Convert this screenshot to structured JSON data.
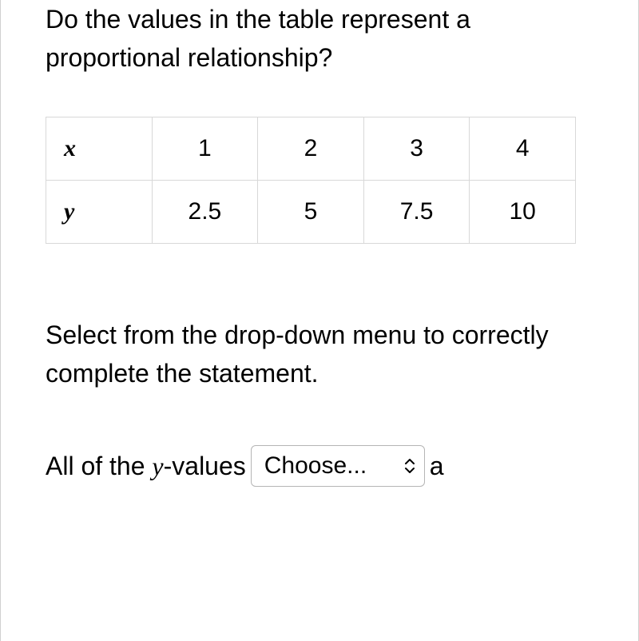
{
  "question1": "Do the values in the table represent a proportional relationship?",
  "table": {
    "rowLabels": [
      "x",
      "y"
    ],
    "rows": [
      [
        "1",
        "2",
        "3",
        "4"
      ],
      [
        "2.5",
        "5",
        "7.5",
        "10"
      ]
    ]
  },
  "question2": "Select from the drop-down menu to correctly complete the statement.",
  "statement": {
    "prefix": "All of the ",
    "varLetter": "y",
    "midfix": "-values",
    "dropdownLabel": "Choose...",
    "suffix": "a"
  }
}
